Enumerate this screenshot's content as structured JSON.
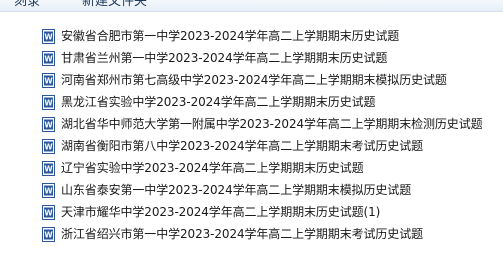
{
  "toolbar": {
    "item1_label": "刻录",
    "item2_label": "新建文件夹"
  },
  "files": [
    {
      "name": "安徽省合肥市第一中学2023-2024学年高二上学期期末历史试题",
      "icon": "word-doc-icon"
    },
    {
      "name": "甘肃省兰州第一中学2023-2024学年高二上学期期末历史试题",
      "icon": "word-doc-icon"
    },
    {
      "name": "河南省郑州市第七高级中学2023-2024学年高二上学期期末模拟历史试题",
      "icon": "word-doc-icon"
    },
    {
      "name": "黑龙江省实验中学2023-2024学年高二上学期期末历史试题",
      "icon": "word-doc-icon"
    },
    {
      "name": "湖北省华中师范大学第一附属中学2023-2024学年高二上学期期末检测历史试题",
      "icon": "word-doc-icon"
    },
    {
      "name": "湖南省衡阳市第八中学2023-2024学年高二上学期期末考试历史试题",
      "icon": "word-doc-icon"
    },
    {
      "name": "辽宁省实验中学2023-2024学年高二上学期期末历史试题",
      "icon": "word-doc-icon"
    },
    {
      "name": "山东省泰安第一中学2023-2024学年高二上学期期末模拟历史试题",
      "icon": "word-doc-icon"
    },
    {
      "name": "天津市耀华中学2023-2024学年高二上学期期末历史试题(1)",
      "icon": "word-doc-icon"
    },
    {
      "name": "浙江省绍兴市第一中学2023-2024学年高二上学期期末考试历史试题",
      "icon": "word-doc-icon"
    }
  ],
  "colors": {
    "word_icon_blue": "#2b579a",
    "toolbar_text": "#1e395b"
  }
}
